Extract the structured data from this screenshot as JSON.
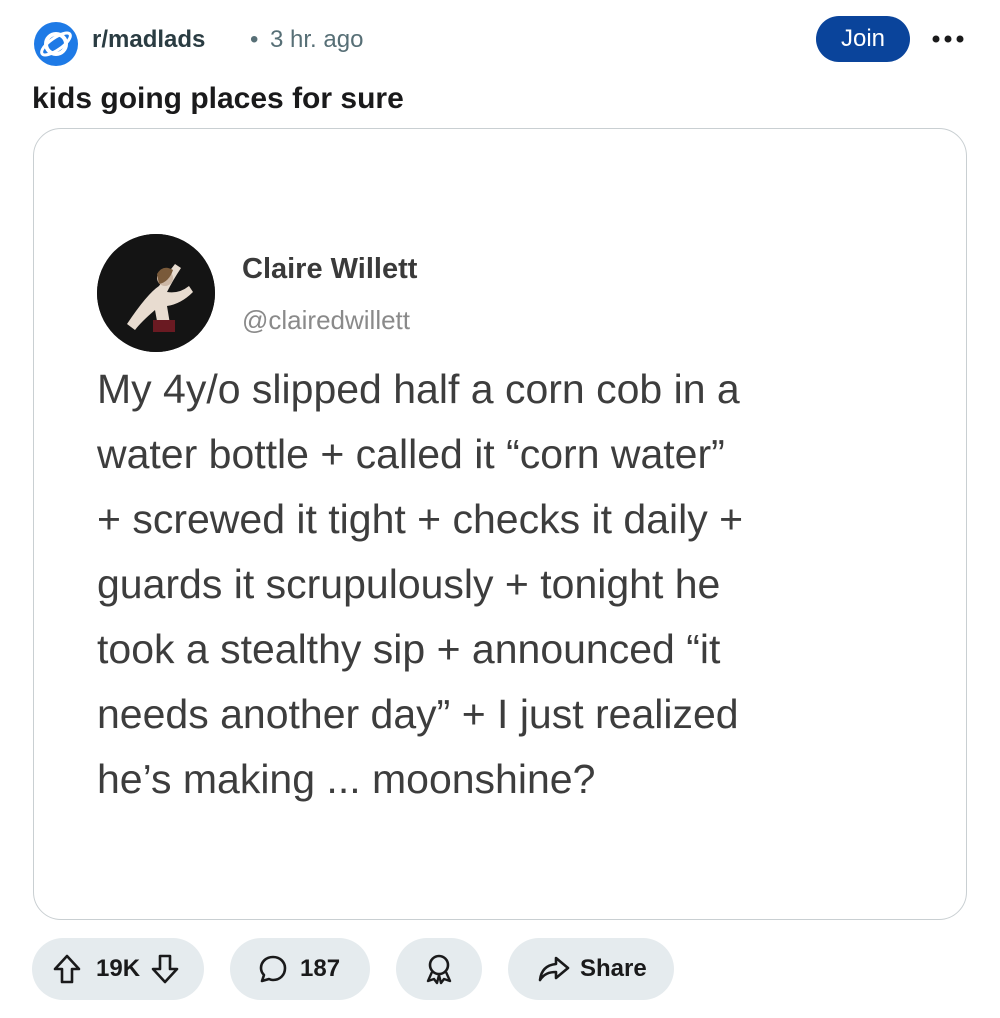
{
  "post": {
    "subreddit": "r/madlads",
    "separator": "•",
    "time_ago": "3 hr. ago",
    "join_label": "Join",
    "more_icon": "ellipsis-icon",
    "title": "kids going places for sure"
  },
  "tweet": {
    "name": "Claire Willett",
    "handle": "@clairedwillett",
    "lines": [
      "My 4y/o slipped half a corn cob in a",
      "water bottle + called it “corn water”",
      "+ screwed it tight + checks it daily +",
      "guards it scrupulously + tonight he",
      "took a stealthy sip + announced “it",
      "needs another day” + I just realized",
      "he’s making ... moonshine?"
    ]
  },
  "actions": {
    "upvote_icon": "upvote-arrow-icon",
    "score": "19K",
    "downvote_icon": "downvote-arrow-icon",
    "comment_icon": "comment-bubble-icon",
    "comments": "187",
    "award_icon": "award-icon",
    "share_icon": "share-arrow-icon",
    "share_label": "Share"
  },
  "colors": {
    "join_button": "#0a449b",
    "subreddit_icon": "#1e7ae6",
    "pill_background": "#e5ebee"
  }
}
